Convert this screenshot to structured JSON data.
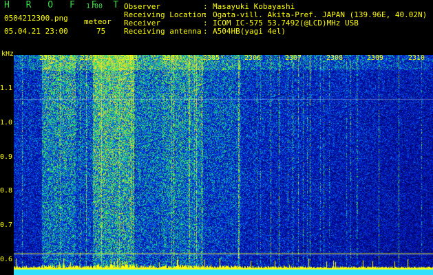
{
  "header": {
    "title": "H R O F F T",
    "version": "1.00",
    "filename": "0504212300.png",
    "mode": "meteor",
    "datetime": "05.04.21 23:00",
    "count": "75"
  },
  "info": [
    {
      "label": "Observer",
      "sep": ":",
      "value": "Masayuki Kobayashi"
    },
    {
      "label": "Receiving Location",
      "sep": ":",
      "value": "Ogata-vill. Akita-Pref. JAPAN (139.96E, 40.02N)"
    },
    {
      "label": "Receiver",
      "sep": ":",
      "value": "ICOM IC-575 53.7492(@LCD)MHz USB"
    },
    {
      "label": "Receiving antenna",
      "sep": ":",
      "value": "A504HB(yagi 4el)"
    }
  ],
  "axis": {
    "unit": "kHz",
    "y_ticks": [
      "1.1",
      "1.0",
      "0.9",
      "0.8",
      "0.7",
      "0.6"
    ],
    "x_ticks": [
      "2301",
      "2302",
      "2303",
      "2304",
      "2305",
      "2306",
      "2307",
      "2308",
      "2309",
      "2310"
    ]
  },
  "colors": {
    "text": "#ffff00",
    "title": "#3fd94a",
    "background": "#000000",
    "activity": "#ffff00"
  }
}
